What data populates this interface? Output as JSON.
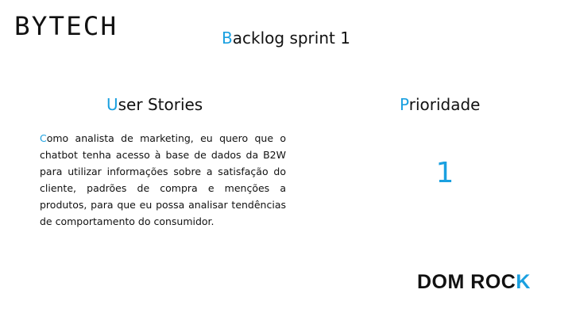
{
  "header": {
    "logo_text": "BYTECH",
    "title_first": "B",
    "title_rest": "acklog sprint 1"
  },
  "columns": {
    "stories_heading_first": "U",
    "stories_heading_rest": "ser Stories",
    "priority_heading_first": "P",
    "priority_heading_rest": "rioridade"
  },
  "story": {
    "first_letter": "C",
    "text_rest": "omo analista de marketing, eu quero que o chatbot tenha acesso à base de dados da B2W para utilizar informações sobre a satisfação do cliente, padrões de compra e menções a produtos, para que eu possa analisar tendências de comportamento do consumidor."
  },
  "priority": {
    "value": "1"
  },
  "footer": {
    "brand_main": "DOM ROC",
    "brand_accent": "K"
  },
  "colors": {
    "accent": "#1aa0e0",
    "text": "#111111",
    "background": "#ffffff"
  }
}
